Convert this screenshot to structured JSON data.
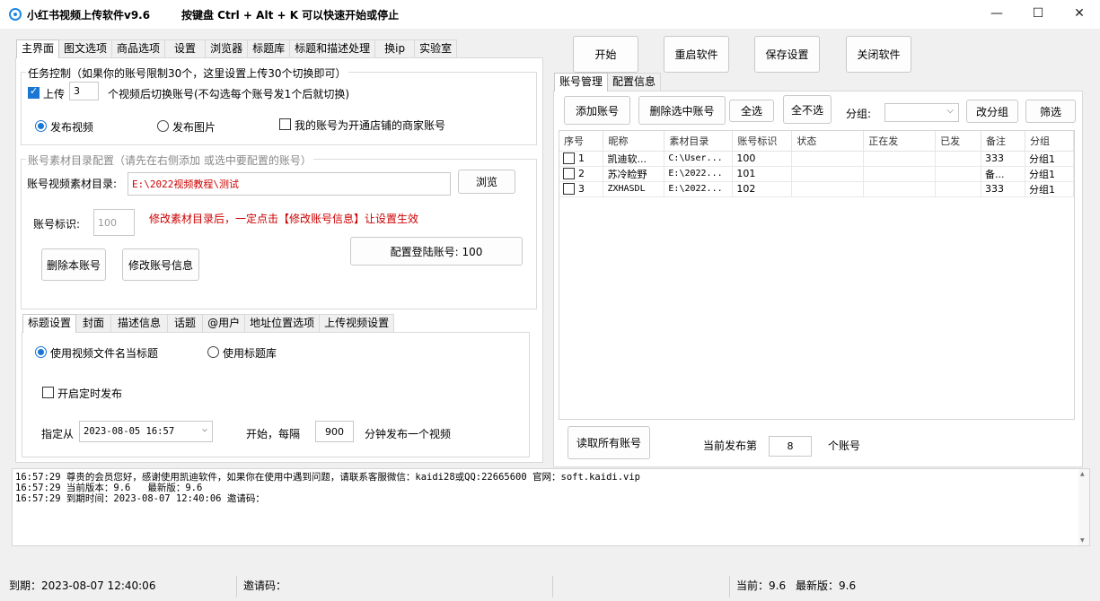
{
  "window": {
    "title": "小红书视频上传软件v9.6",
    "hotkey_hint": "按键盘 Ctrl + Alt + K  可以快速开始或停止",
    "minimize": "—",
    "maximize": "☐",
    "close": "✕"
  },
  "left_tabs": [
    "主界面",
    "图文选项",
    "商品选项",
    "设置",
    "浏览器",
    "标题库",
    "标题和描述处理",
    "换ip",
    "实验室"
  ],
  "task": {
    "group_title": "任务控制（如果你的账号限制30个，这里设置上传30个切换即可）",
    "upload_label": "上传",
    "upload_count": "3",
    "switch_text": "个视频后切换账号(不勾选每个账号发1个后就切换)",
    "radio_video": "发布视频",
    "radio_image": "发布图片",
    "merchant_label": "我的账号为开通店铺的商家账号"
  },
  "material": {
    "group_title": "账号素材目录配置（请先在右侧添加 或选中要配置的账号）",
    "dir_label": "账号视频素材目录:",
    "dir_value": "E:\\2022视频教程\\测试",
    "browse_button": "浏览",
    "id_label": "账号标识:",
    "id_value": "100",
    "warning": "修改素材目录后，一定点击【修改账号信息】让设置生效",
    "delete_button": "删除本账号",
    "modify_button": "修改账号信息",
    "config_login_button": "配置登陆账号: 100"
  },
  "sub_tabs": [
    "标题设置",
    "封面",
    "描述信息",
    "话题",
    "@用户",
    "地址位置选项",
    "上传视频设置"
  ],
  "title_settings": {
    "radio_filename": "使用视频文件名当标题",
    "radio_library": "使用标题库",
    "schedule_label": "开启定时发布",
    "specify_from": "指定从",
    "datetime": "2023-08-05 16:57",
    "start_every": "开始，每隔",
    "interval": "900",
    "interval_suffix": "分钟发布一个视频"
  },
  "top_buttons": [
    "开始",
    "重启软件",
    "保存设置",
    "关闭软件"
  ],
  "right_tabs": [
    "账号管理",
    "配置信息"
  ],
  "account_toolbar": {
    "add": "添加账号",
    "delete_selected": "删除选中账号",
    "select_all": "全选",
    "select_none": "全不选",
    "group_label": "分组:",
    "change_group": "改分组",
    "filter": "筛选"
  },
  "table": {
    "headers": [
      "序号",
      "昵称",
      "素材目录",
      "账号标识",
      "状态",
      "正在发",
      "已发",
      "备注",
      "分组"
    ],
    "rows": [
      {
        "no": "1",
        "nickname": "凯迪软...",
        "dir": "C:\\User...",
        "id": "100",
        "status": "",
        "sending": "",
        "sent": "",
        "note": "333",
        "group": "分组1"
      },
      {
        "no": "2",
        "nickname": "苏冷睑野",
        "dir": "E:\\2022...",
        "id": "101",
        "status": "",
        "sending": "",
        "sent": "",
        "note": "备...",
        "group": "分组1"
      },
      {
        "no": "3",
        "nickname": "ZXHASDL",
        "dir": "E:\\2022...",
        "id": "102",
        "status": "",
        "sending": "",
        "sent": "",
        "note": "333",
        "group": "分组1"
      }
    ]
  },
  "bottom_right": {
    "read_all": "读取所有账号",
    "current_prefix": "当前发布第",
    "current_value": "8",
    "current_suffix": "个账号"
  },
  "log_lines": [
    "16:57:29 尊贵的会员您好，感谢使用凯迪软件，如果你在使用中遇到问题，请联系客服微信：kaidi28或QQ:22665600 官网：soft.kaidi.vip",
    "16:57:29 当前版本：9.6   最新版：9.6",
    "16:57:29 到期时间：2023-08-07 12:40:06 邀请码："
  ],
  "status": {
    "expire": "到期：2023-08-07 12:40:06",
    "invite": "邀请码：",
    "current_version": "当前：9.6",
    "latest_version": "最新版：9.6"
  },
  "colors": {
    "accent": "#1976d2",
    "warning_red": "#cc0000"
  }
}
